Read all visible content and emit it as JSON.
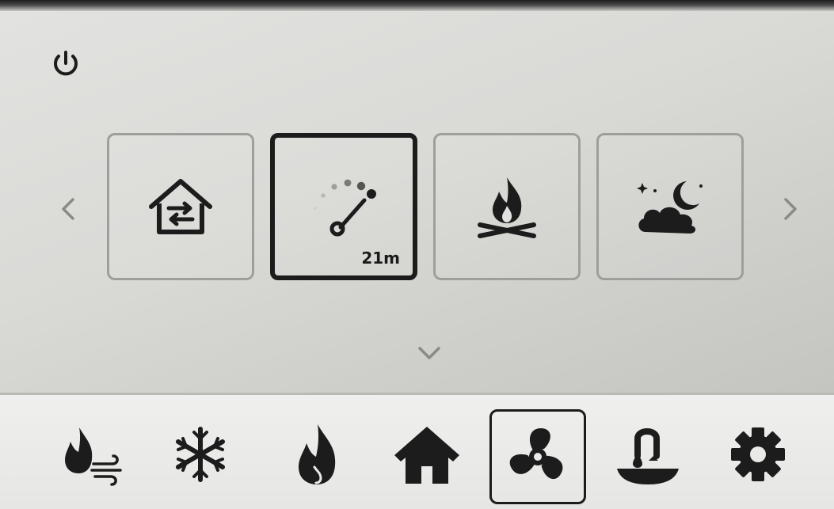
{
  "power": {
    "icon": "power-icon"
  },
  "carousel": {
    "prev_icon": "chevron-left-icon",
    "next_icon": "chevron-right-icon",
    "expand_icon": "chevron-down-icon",
    "tiles": [
      {
        "icon": "home-exchange-icon",
        "badge": ""
      },
      {
        "icon": "speed-gauge-icon",
        "badge": "21m",
        "selected": true
      },
      {
        "icon": "campfire-icon",
        "badge": ""
      },
      {
        "icon": "night-cloud-moon-icon",
        "badge": ""
      }
    ]
  },
  "nav": {
    "items": [
      {
        "icon": "flame-wind-icon"
      },
      {
        "icon": "snowflake-icon"
      },
      {
        "icon": "flame-icon"
      },
      {
        "icon": "home-icon"
      },
      {
        "icon": "fan-icon",
        "selected": true
      },
      {
        "icon": "faucet-basin-icon"
      },
      {
        "icon": "gear-icon"
      }
    ]
  },
  "colors": {
    "icon": "#1c1c1c",
    "tile_border": "#9e9e9b",
    "chevron": "#8a8a88",
    "background": "#e2e2e0"
  }
}
